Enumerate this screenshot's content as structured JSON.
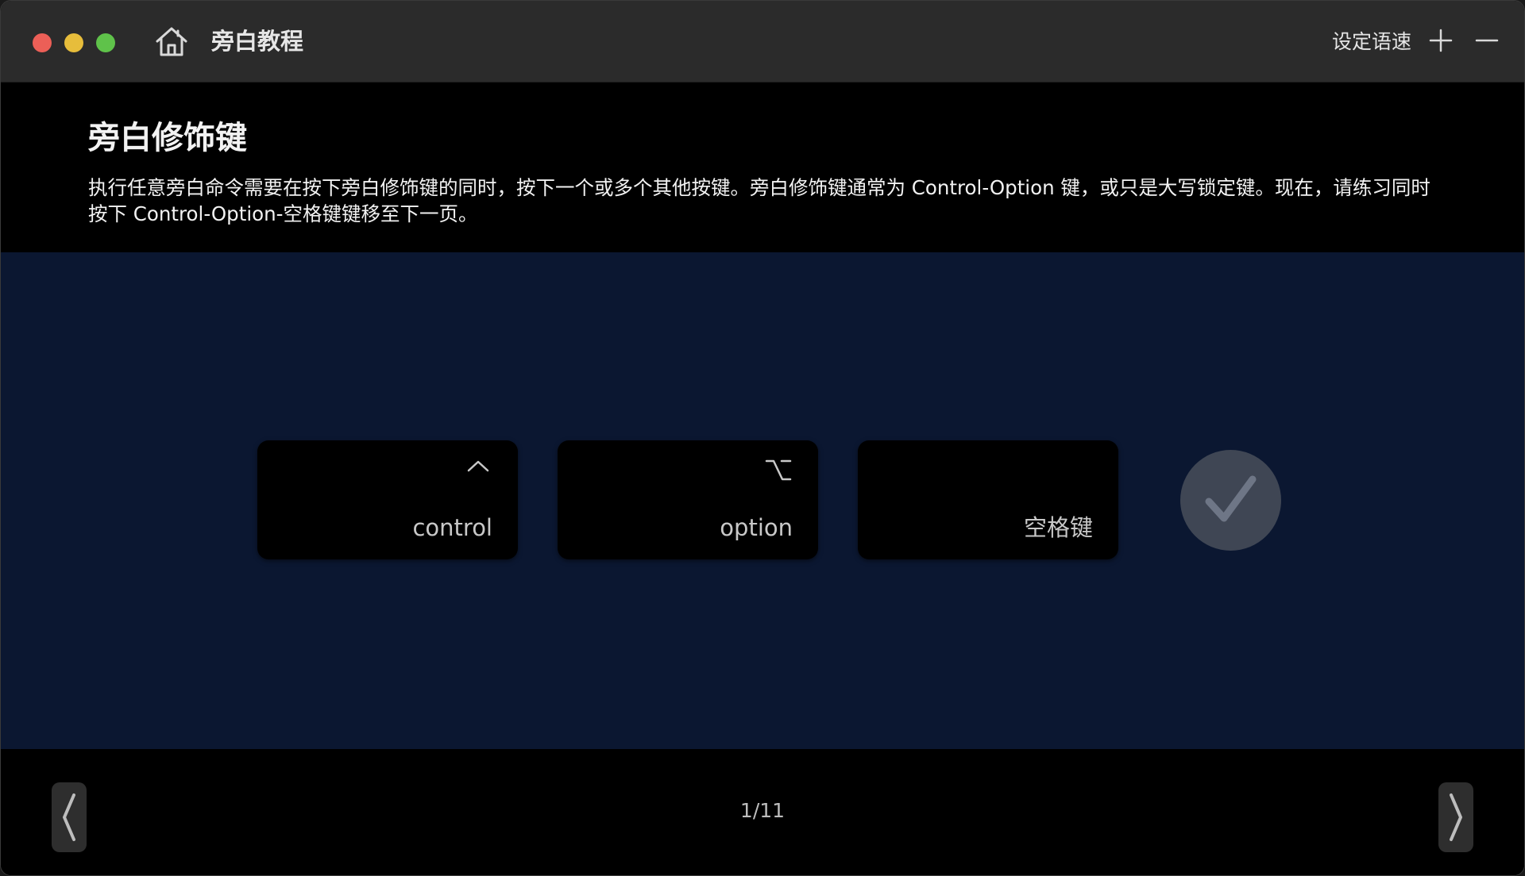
{
  "window": {
    "title": "旁白教程",
    "speed_label": "设定语速"
  },
  "icons": {
    "home": "home-icon",
    "plus": "plus-icon",
    "minus": "minus-icon",
    "control": "control-key-symbol-icon",
    "option": "option-key-symbol-icon",
    "check": "checkmark-icon",
    "prev": "chevron-left-icon",
    "next": "chevron-right-icon"
  },
  "header": {
    "heading": "旁白修饰键",
    "description": "执行任意旁白命令需要在按下旁白修饰键的同时，按下一个或多个其他按键。旁白修饰键通常为 Control-Option 键，或只是大写锁定键。现在，请练习同时按下 Control-Option-空格键键移至下一页。"
  },
  "keys": [
    {
      "label": "control"
    },
    {
      "label": "option"
    },
    {
      "label": "空格键"
    }
  ],
  "footer": {
    "page_indicator": "1/11"
  },
  "colors": {
    "titlebar": "#2b2b2b",
    "stage": "#0b1731",
    "traffic_close": "#ec5f57",
    "traffic_minimize": "#e7bd3b",
    "traffic_zoom": "#5fc24a"
  }
}
